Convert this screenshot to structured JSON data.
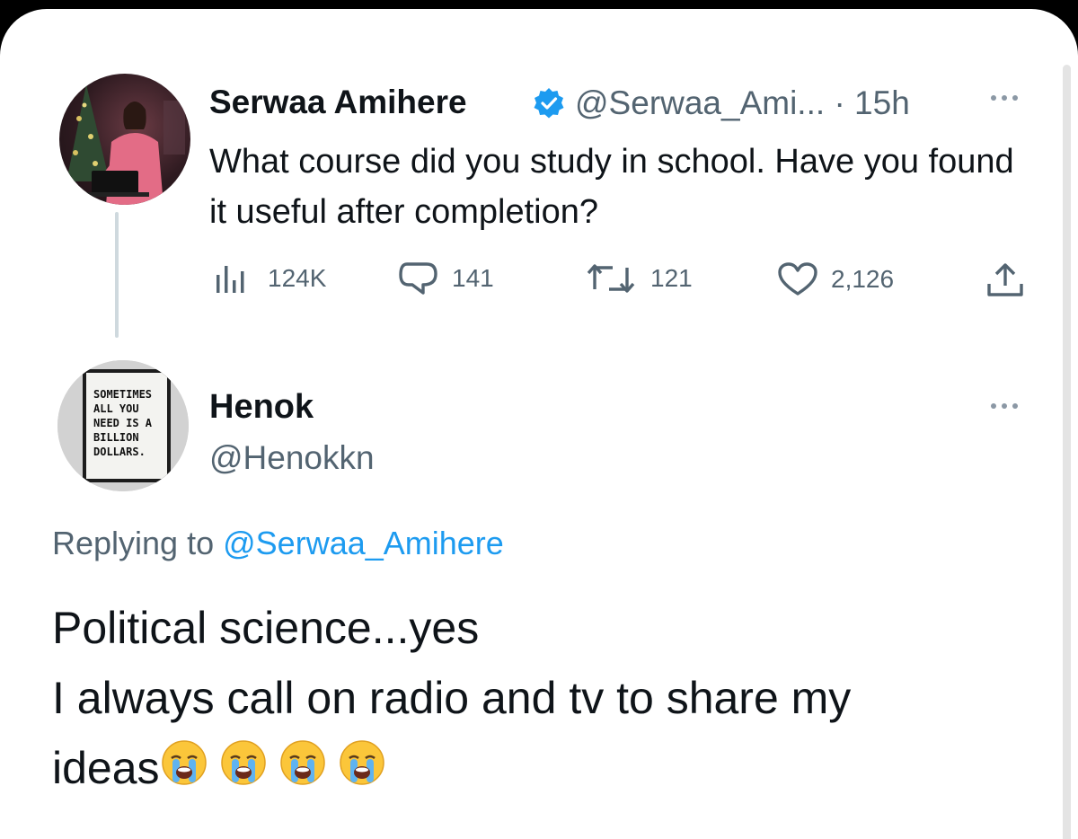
{
  "original_tweet": {
    "author_name": "Serwaa Amihere",
    "author_handle": "@Serwaa_Ami...",
    "separator_time": "· 15h",
    "text": "What course did you study in school. Have you found it useful after completion?",
    "metrics": {
      "views": "124K",
      "replies": "141",
      "retweets": "121",
      "likes": "2,126"
    }
  },
  "reply_tweet": {
    "author_name": "Henok",
    "author_handle": "@Henokkn",
    "avatar_text": [
      "SOMETIMES",
      "ALL YOU",
      "NEED IS A",
      "BILLION",
      "DOLLARS."
    ],
    "replying_prefix": "Replying to",
    "replying_to": "@Serwaa_Amihere",
    "text_line1": "Political science...yes",
    "text_line2": "I always call on radio and tv to share my",
    "text_line3": "ideas"
  },
  "icons": {
    "verified": "verified-badge-icon",
    "more": "more-dots-icon",
    "views": "views-chart-icon",
    "reply": "reply-bubble-icon",
    "retweet": "retweet-arrows-icon",
    "like": "heart-icon",
    "share": "share-upload-icon",
    "emoji": "loudly-crying-face-emoji"
  },
  "colors": {
    "accent": "#1d9bf0",
    "secondary_text": "#536471",
    "primary_text": "#0f1419"
  }
}
